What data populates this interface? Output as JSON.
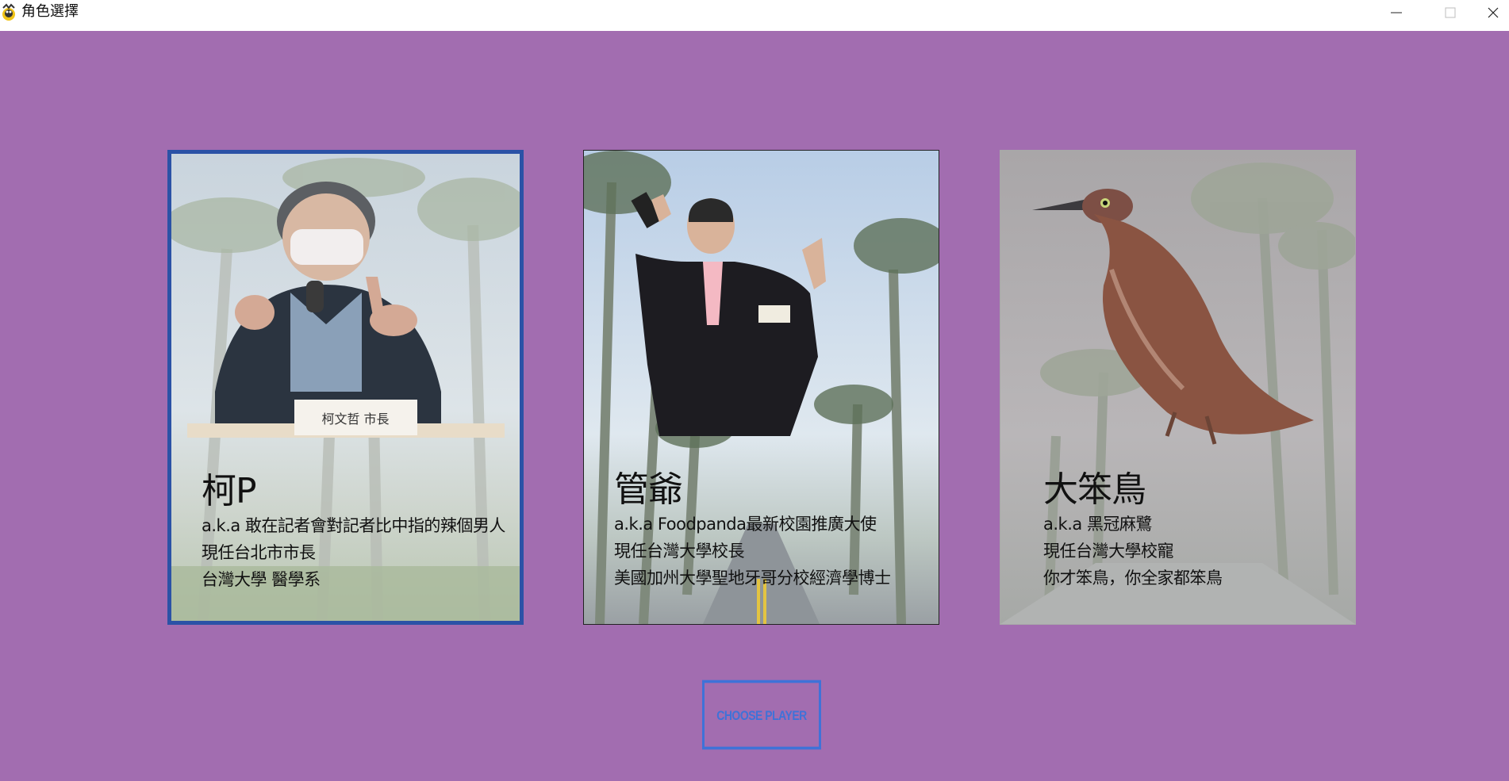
{
  "window": {
    "title": "角色選擇",
    "background_color": "#a26db0",
    "controls": {
      "minimize_icon": "minimize-icon",
      "maximize_icon": "maximize-icon",
      "close_icon": "close-icon"
    }
  },
  "characters": [
    {
      "name": "柯P",
      "lines": [
        "a.k.a 敢在記者會對記者比中指的辣個男人",
        "現任台北市市長",
        "台灣大學 醫學系"
      ],
      "sign_text": "柯文哲  市長",
      "selected": true,
      "border_color": "#2b52a6"
    },
    {
      "name": "管爺",
      "lines": [
        "a.k.a Foodpanda最新校園推廣大使",
        "現任台灣大學校長",
        "美國加州大學聖地牙哥分校經濟學博士"
      ],
      "selected": false
    },
    {
      "name": "大笨鳥",
      "lines": [
        "a.k.a 黑冠麻鷺",
        "現任台灣大學校寵",
        "你才笨鳥，你全家都笨鳥"
      ],
      "selected": false,
      "dimmed": true
    }
  ],
  "choose_button": {
    "label": "CHOOSE PLAYER",
    "color": "#3f72d8"
  }
}
